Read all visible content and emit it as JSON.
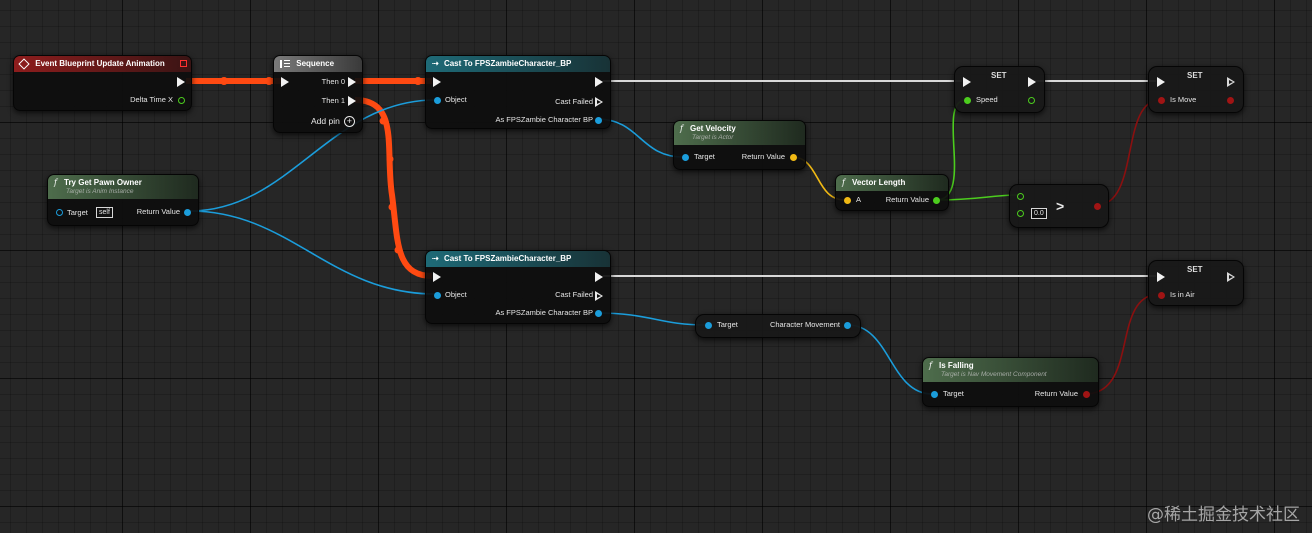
{
  "nodes": {
    "event_update": {
      "title": "Event Blueprint Update Animation",
      "pin_delta": "Delta Time X"
    },
    "sequence": {
      "title": "Sequence",
      "then0": "Then 0",
      "then1": "Then 1",
      "add_pin": "Add pin"
    },
    "cast_top": {
      "title": "Cast To FPSZambieCharacter_BP",
      "object": "Object",
      "cast_failed": "Cast Failed",
      "as_out": "As FPSZambie Character BP"
    },
    "cast_bottom": {
      "title": "Cast To FPSZambieCharacter_BP",
      "object": "Object",
      "cast_failed": "Cast Failed",
      "as_out": "As FPSZambie Character BP"
    },
    "try_get_pawn": {
      "title": "Try Get Pawn Owner",
      "subtitle": "Target is Anim Instance",
      "target": "Target",
      "self_value": "self",
      "return": "Return Value"
    },
    "get_velocity": {
      "title": "Get Velocity",
      "subtitle": "Target is Actor",
      "target": "Target",
      "return": "Return Value"
    },
    "vector_length": {
      "title": "Vector Length",
      "a": "A",
      "return": "Return Value"
    },
    "compare": {
      "op": ">",
      "value": "0.0"
    },
    "set_speed": {
      "title": "SET",
      "var": "Speed"
    },
    "set_is_move": {
      "title": "SET",
      "var": "Is Move"
    },
    "set_is_in_air": {
      "title": "SET",
      "var": "Is in Air"
    },
    "char_movement": {
      "target": "Target",
      "output": "Character Movement"
    },
    "is_falling": {
      "title": "Is Falling",
      "subtitle": "Target is Nav Movement Component",
      "target": "Target",
      "return": "Return Value"
    }
  },
  "icons": {
    "function": "f",
    "event": "diamond-icon",
    "sequence": "sequence-icon",
    "cast": "cast-arrow-icon"
  },
  "colors": {
    "exec_active": "#ff4a12",
    "exec": "#e6e6e6",
    "object_pin": "#1b9ddb",
    "float_pin": "#4ccd1e",
    "vector_pin": "#f0b914",
    "bool_pin": "#a01414"
  },
  "watermark": "@稀土掘金技术社区"
}
